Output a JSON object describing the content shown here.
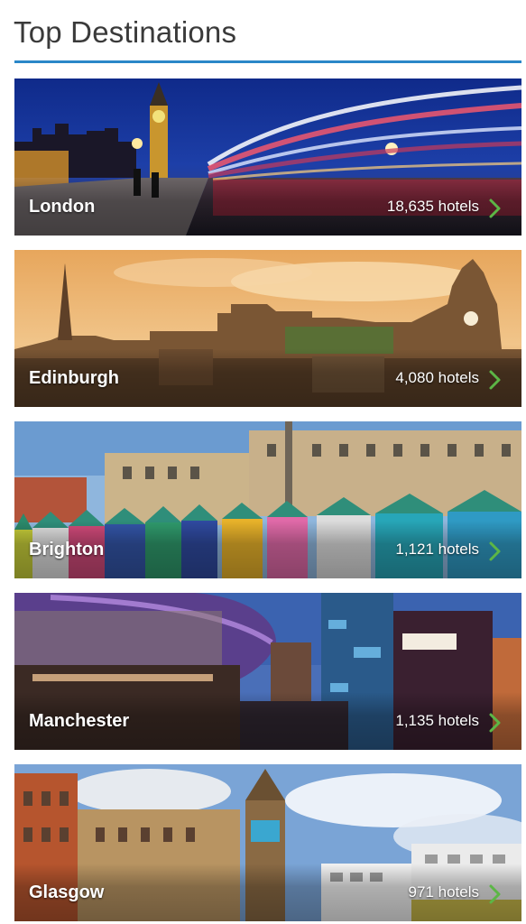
{
  "header": {
    "title": "Top Destinations",
    "accent_color": "#2a87c8"
  },
  "destinations": [
    {
      "city": "London",
      "hotels": "18,635 hotels",
      "chevron_icon": "chevron-right-icon",
      "chevron_color": "#5cb646"
    },
    {
      "city": "Edinburgh",
      "hotels": "4,080 hotels",
      "chevron_icon": "chevron-right-icon",
      "chevron_color": "#5cb646"
    },
    {
      "city": "Brighton",
      "hotels": "1,121 hotels",
      "chevron_icon": "chevron-right-icon",
      "chevron_color": "#5cb646"
    },
    {
      "city": "Manchester",
      "hotels": "1,135 hotels",
      "chevron_icon": "chevron-right-icon",
      "chevron_color": "#5cb646"
    },
    {
      "city": "Glasgow",
      "hotels": "971 hotels",
      "chevron_icon": "chevron-right-icon",
      "chevron_color": "#5cb646"
    }
  ]
}
